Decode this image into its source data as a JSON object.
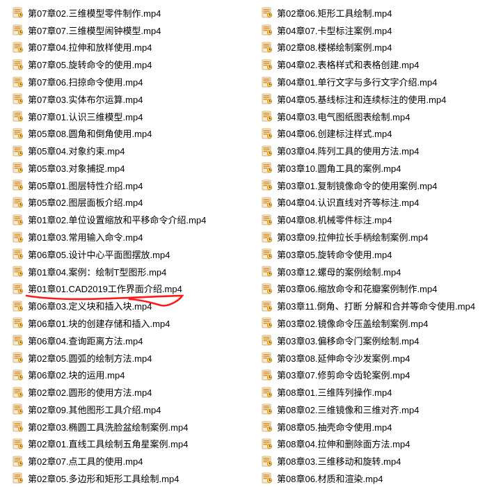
{
  "icon_colors": {
    "page": "#f7ead0",
    "page_edge": "#caa35a",
    "bar": "#d98b2b"
  },
  "highlight_color": "#ff1a1a",
  "highlight_index_left": 14,
  "left": [
    "第07章02.三维模型零件制作.mp4",
    "第07章07.三维模型闹钟模型.mp4",
    "第07章04.拉伸和放样使用.mp4",
    "第07章05.旋转命令的使用.mp4",
    "第07章06.扫掠命令使用.mp4",
    "第07章03.实体布尔运算.mp4",
    "第07章01.认识三维模型.mp4",
    "第05章08.圆角和倒角使用.mp4",
    "第05章04.对象约束.mp4",
    "第05章03.对象捕捉.mp4",
    "第05章01.图层特性介绍.mp4",
    "第05章02.图层面板介绍.mp4",
    "第01章02.单位设置缩放和平移命令介绍.mp4",
    "第01章03.常用输入命令.mp4",
    "第06章05.设计中心平面图摆放.mp4",
    "第01章04.案例：绘制T型图形.mp4",
    "第01章01.CAD2019工作界面介绍.mp4",
    "第06章03.定义块和插入块.mp4",
    "第06章01.块的创建存储和插入.mp4",
    "第06章04.查询距离方法.mp4",
    "第02章05.圆弧的绘制方法.mp4",
    "第06章02.块的运用.mp4",
    "第02章02.圆形的使用方法.mp4",
    "第02章09.其他图形工具介绍.mp4",
    "第02章03.椭圆工具洗脸盆绘制案例.mp4",
    "第02章01.直线工具绘制五角星案例.mp4",
    "第02章07.点工具的使用.mp4",
    "第02章05.多边形和矩形工具绘制.mp4"
  ],
  "right": [
    "第02章06.矩形工具绘制.mp4",
    "第04章07.卡型标注案例.mp4",
    "第02章08.楼梯绘制案例.mp4",
    "第04章02.表格样式和表格创建.mp4",
    "第04章01.单行文字与多行文字介绍.mp4",
    "第04章05.基线标注和连续标注的使用.mp4",
    "第04章03.电气图纸图表绘制.mp4",
    "第04章06.创建标注样式.mp4",
    "第03章04.阵列工具的使用方法.mp4",
    "第03章10.圆角工具的案例.mp4",
    "第03章01.复制镜像命令的使用案例.mp4",
    "第04章04.认识直线对齐等标注.mp4",
    "第04章08.机械零件标注.mp4",
    "第03章09.拉伸拉长手柄绘制案例.mp4",
    "第03章05.旋转命令使用.mp4",
    "第03章12.螺母的案例绘制.mp4",
    "第03章06.缩放命令和花瓣案例制作.mp4",
    "第03章11.倒角、打断 分解和合并等命令使用.mp4",
    "第03章02.镜像命令压盖绘制案例.mp4",
    "第03章03.偏移命令门案例绘制.mp4",
    "第03章08.延伸命令沙发案例.mp4",
    "第03章07.修剪命令齿轮案例.mp4",
    "第08章01.三维阵列操作.mp4",
    "第08章02.三维镜像和三维对齐.mp4",
    "第08章05.抽壳命令使用.mp4",
    "第08章04.拉伸和删除面方法.mp4",
    "第08章03.三维移动和旋转.mp4",
    "第08章06.材质和渲染.mp4"
  ]
}
